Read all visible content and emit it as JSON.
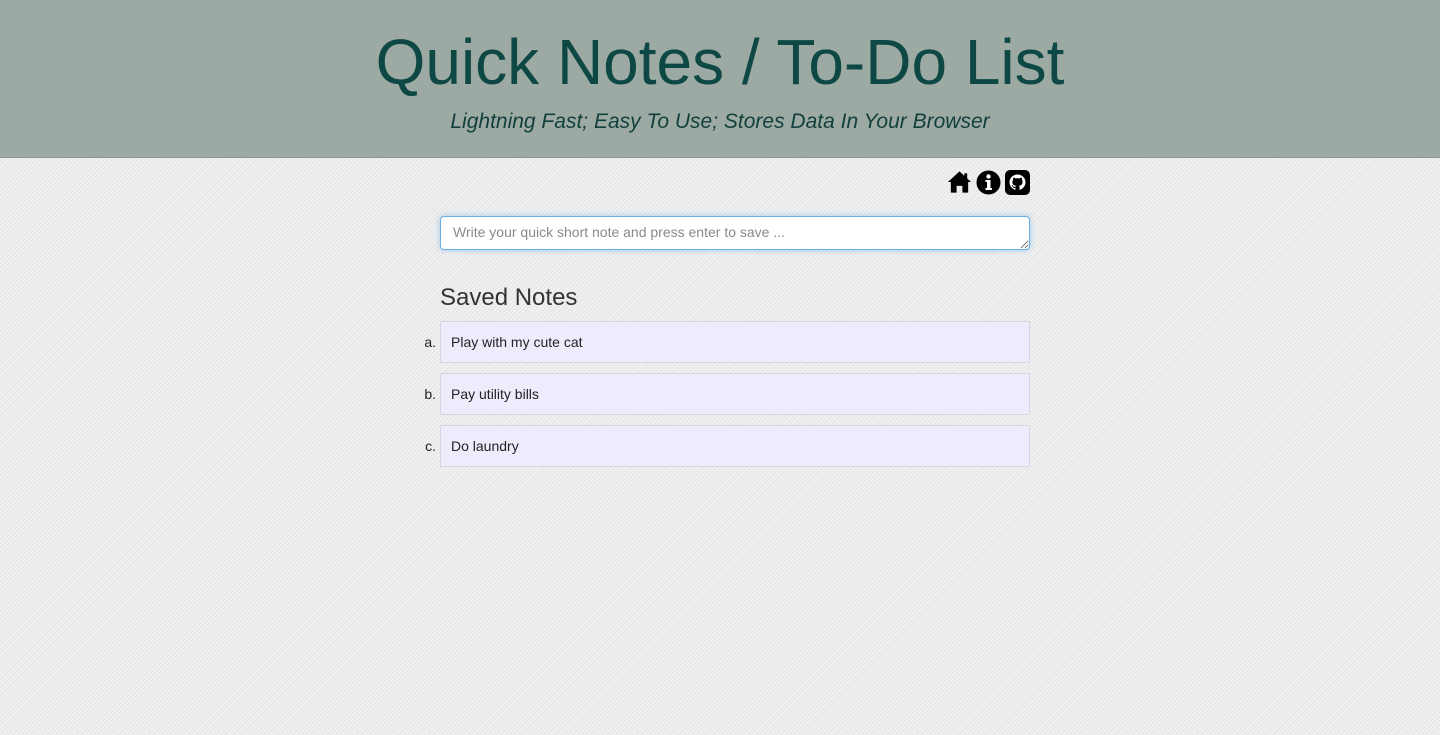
{
  "header": {
    "title": "Quick Notes / To-Do List",
    "subtitle": "Lightning Fast; Easy To Use; Stores Data In Your Browser",
    "background_color": "#9caaa3",
    "title_color": "#0d4844"
  },
  "toolbar": {
    "icons": [
      "home-icon",
      "info-icon",
      "github-icon"
    ]
  },
  "note_input": {
    "placeholder": "Write your quick short note and press enter to save ...",
    "value": ""
  },
  "saved_notes": {
    "heading": "Saved Notes",
    "items": [
      {
        "marker": "a.",
        "text": "Play with my cute cat"
      },
      {
        "marker": "b.",
        "text": "Pay utility bills"
      },
      {
        "marker": "c.",
        "text": "Do laundry"
      }
    ],
    "item_background": "#efebfc"
  }
}
